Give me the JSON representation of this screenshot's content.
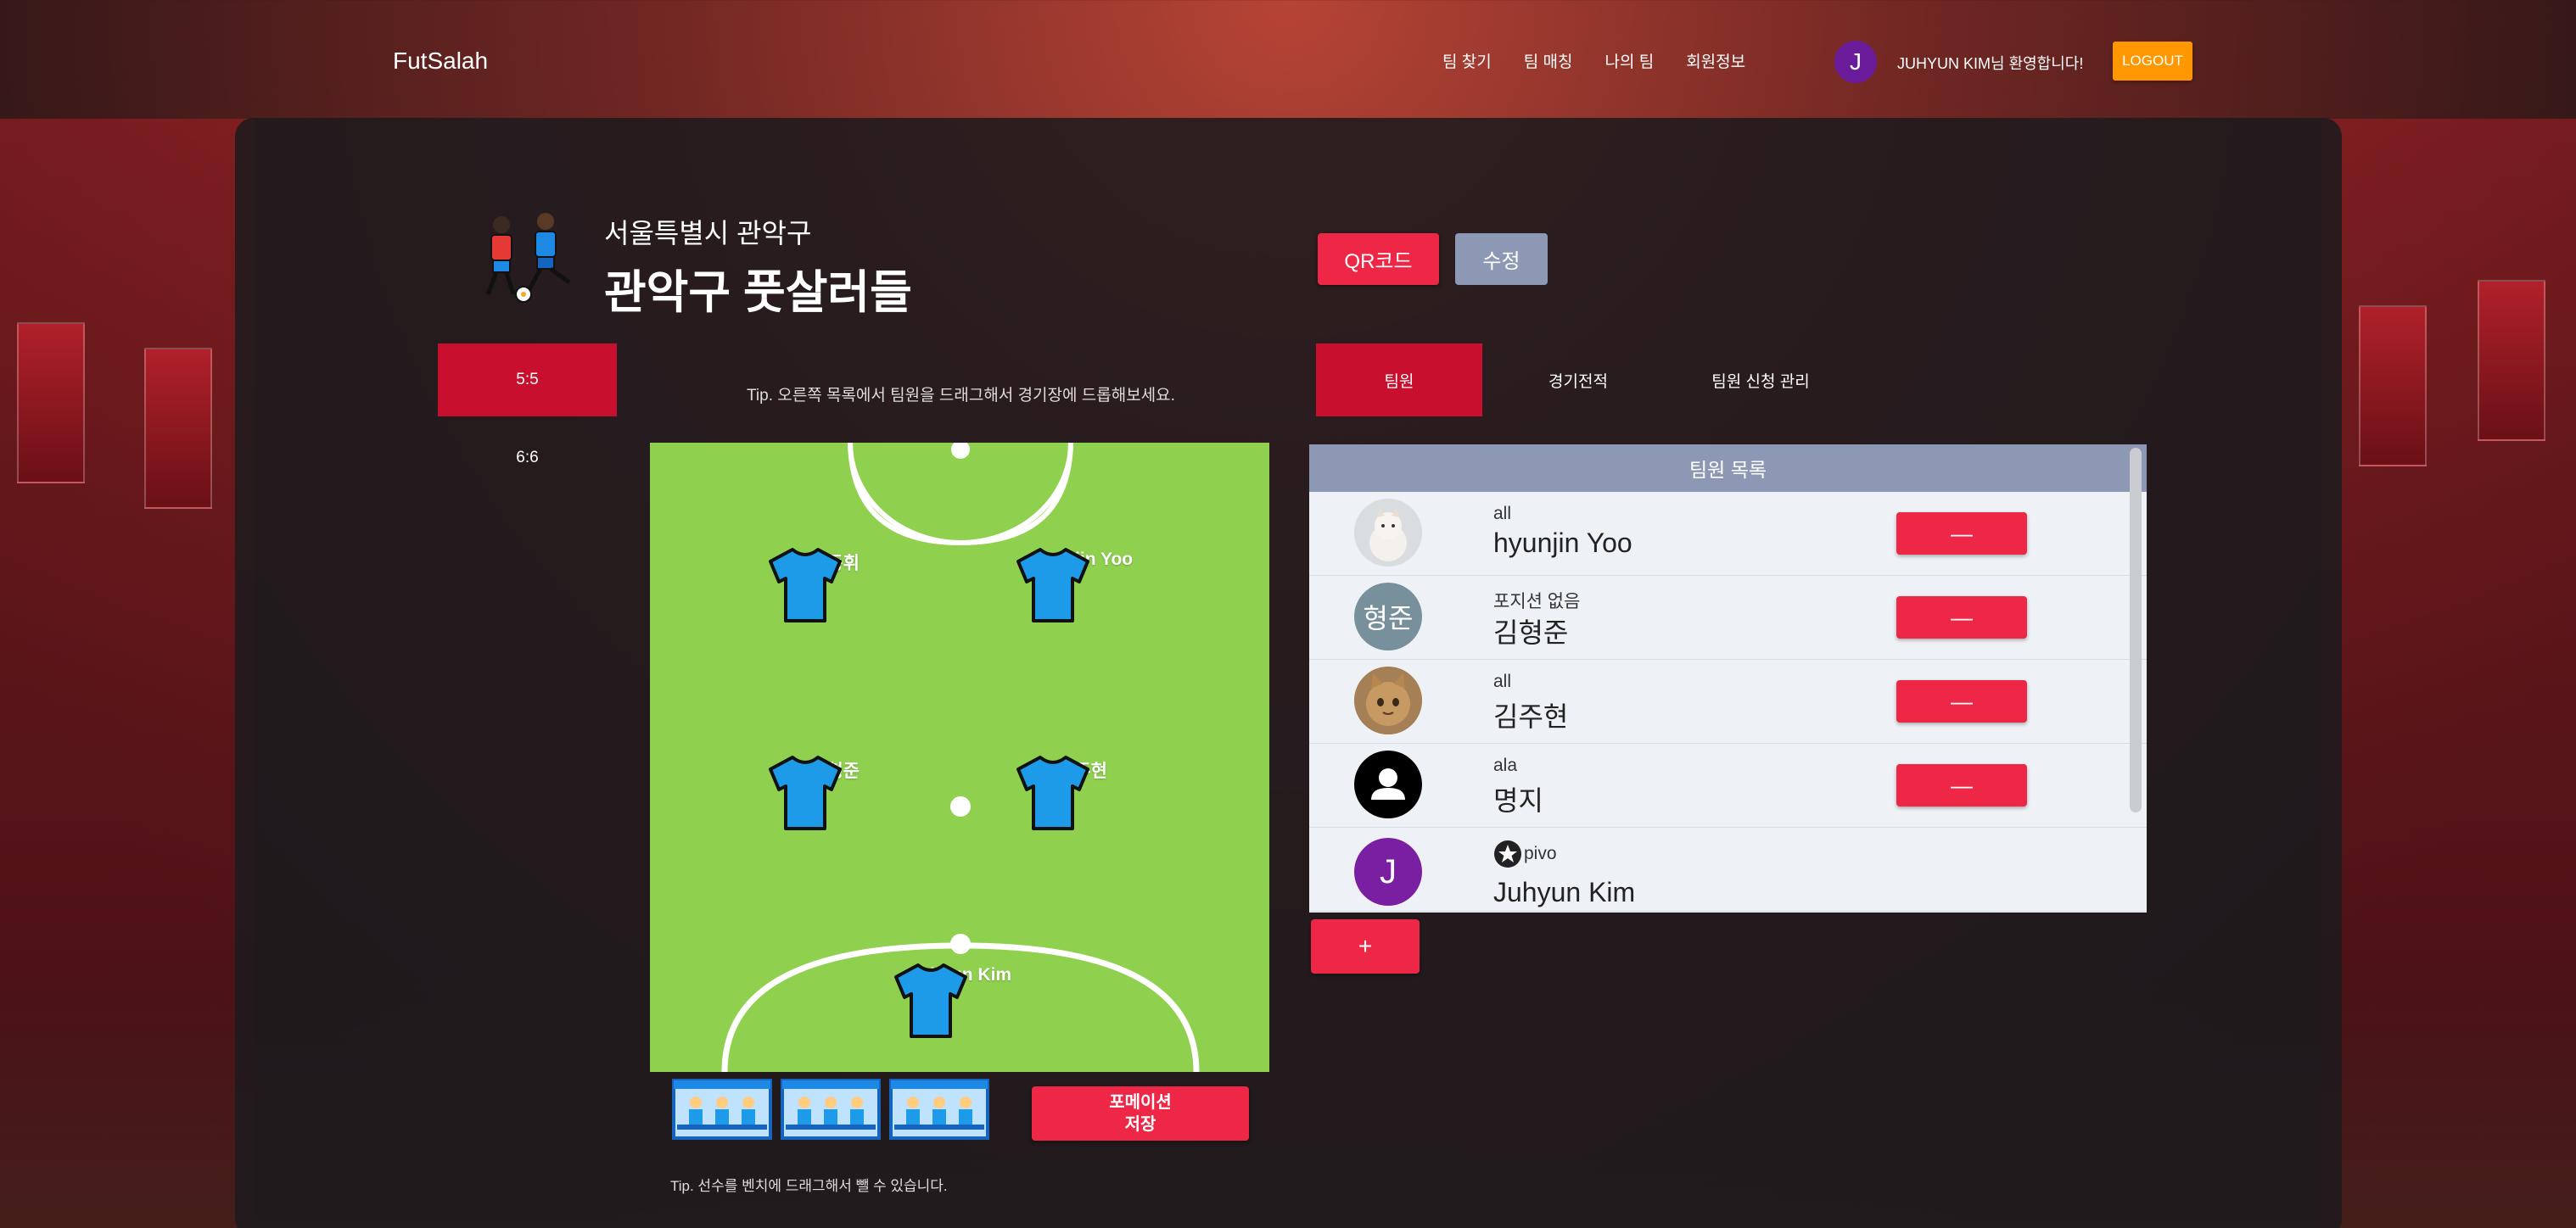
{
  "nav": {
    "brand": "FutSalah",
    "links": [
      "팀 찾기",
      "팀 매칭",
      "나의 팀",
      "회원정보"
    ],
    "user_initial": "J",
    "welcome": "JUHYUN KIM님 환영합니다!",
    "logout": "LOGOUT"
  },
  "team": {
    "region": "서울특별시 관악구",
    "name": "관악구 풋살러들",
    "qr_button": "QR코드",
    "edit_button": "수정"
  },
  "formation_tabs": [
    "5:5",
    "6:6"
  ],
  "tip_top": "Tip. 오른쪽 목록에서 팀원을 드래그해서 경기장에 드롭해보세요.",
  "field": {
    "players": [
      "김동휘",
      "hyunjin Yoo",
      "김형준",
      "김주현",
      "Juhyun Kim"
    ]
  },
  "save_formation": {
    "line1": "포메이션",
    "line2": "저장"
  },
  "tip_bottom": "Tip. 선수를 벤치에 드래그해서 뺄 수 있습니다.",
  "right_tabs": [
    "팀원",
    "경기전적",
    "팀원 신청 관리"
  ],
  "member_list": {
    "title": "팀원 목록",
    "members": [
      {
        "position": "all",
        "name": "hyunjin Yoo",
        "avatar_text": "",
        "remove": "—"
      },
      {
        "position": "포지션 없음",
        "name": "김형준",
        "avatar_text": "형준",
        "remove": "—"
      },
      {
        "position": "all",
        "name": "김주현",
        "avatar_text": "",
        "remove": "—"
      },
      {
        "position": "ala",
        "name": "명지",
        "avatar_text": "",
        "remove": "—"
      },
      {
        "position": "pivo",
        "name": "Juhyun Kim",
        "avatar_text": "J",
        "remove": ""
      }
    ],
    "add_button": "+"
  },
  "colors": {
    "accent_red": "#ee2746",
    "active_tab": "#c8102e",
    "logout_orange": "#ff9800",
    "field_green": "#8fd14f",
    "jersey_blue": "#1e9be8",
    "header_gray": "#8d99b4"
  }
}
